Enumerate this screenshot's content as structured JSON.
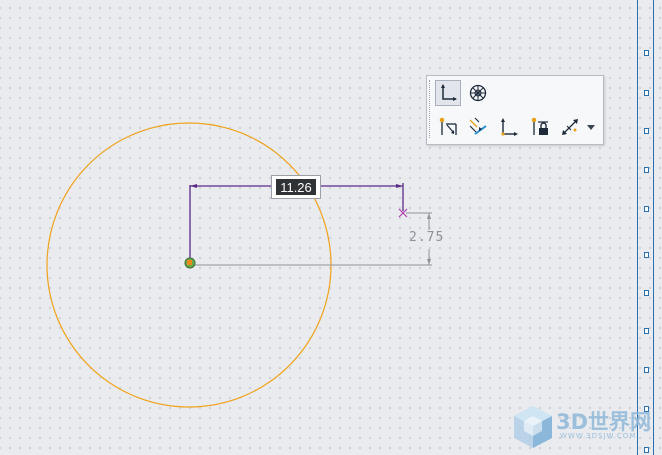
{
  "sketch": {
    "dimension_active_value": "11.26",
    "dimension_weak_value": "2.75"
  },
  "snap_toolbar": {
    "buttons": [
      {
        "icon": "cartesian-grid-icon"
      },
      {
        "icon": "polar-grid-icon"
      },
      {
        "icon": "point-on-entity-icon"
      },
      {
        "icon": "point-on-line-icon"
      },
      {
        "icon": "axis-snap-icon"
      },
      {
        "icon": "lock-point-icon"
      },
      {
        "icon": "dimension-snap-icon"
      },
      {
        "icon": "dropdown-arrow-icon"
      }
    ]
  },
  "watermark": {
    "brand": "3D世界网",
    "url": "WWW.3DSJW.COM"
  },
  "colors": {
    "circle": "#f0a21a",
    "dimension_active": "#5a2a86",
    "construction": "#8e939a",
    "ruler": "#2a6fb0"
  }
}
